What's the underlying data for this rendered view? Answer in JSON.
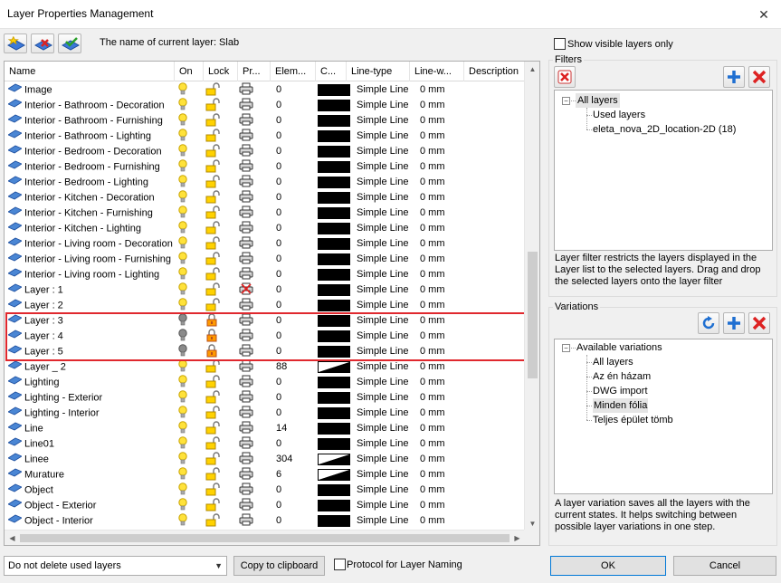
{
  "window": {
    "title": "Layer Properties Management",
    "close_glyph": "✕"
  },
  "toolbar": {
    "current_layer_text": "The name of current layer: Slab"
  },
  "columns": {
    "name": "Name",
    "on": "On",
    "lock": "Lock",
    "print": "Pr...",
    "elements": "Elem...",
    "color": "C...",
    "linetype": "Line-type",
    "linewidth": "Line-w...",
    "description": "Description"
  },
  "layers": [
    {
      "name": "Image",
      "on": true,
      "locked": false,
      "print": true,
      "elements": "0",
      "color": "solid",
      "linetype": "Simple Line",
      "linewidth": "0 mm"
    },
    {
      "name": "Interior - Bathroom - Decoration",
      "on": true,
      "locked": false,
      "print": true,
      "elements": "0",
      "color": "solid",
      "linetype": "Simple Line",
      "linewidth": "0 mm"
    },
    {
      "name": "Interior - Bathroom - Furnishing",
      "on": true,
      "locked": false,
      "print": true,
      "elements": "0",
      "color": "solid",
      "linetype": "Simple Line",
      "linewidth": "0 mm"
    },
    {
      "name": "Interior - Bathroom - Lighting",
      "on": true,
      "locked": false,
      "print": true,
      "elements": "0",
      "color": "solid",
      "linetype": "Simple Line",
      "linewidth": "0 mm"
    },
    {
      "name": "Interior - Bedroom - Decoration",
      "on": true,
      "locked": false,
      "print": true,
      "elements": "0",
      "color": "solid",
      "linetype": "Simple Line",
      "linewidth": "0 mm"
    },
    {
      "name": "Interior - Bedroom - Furnishing",
      "on": true,
      "locked": false,
      "print": true,
      "elements": "0",
      "color": "solid",
      "linetype": "Simple Line",
      "linewidth": "0 mm"
    },
    {
      "name": "Interior - Bedroom - Lighting",
      "on": true,
      "locked": false,
      "print": true,
      "elements": "0",
      "color": "solid",
      "linetype": "Simple Line",
      "linewidth": "0 mm"
    },
    {
      "name": "Interior - Kitchen - Decoration",
      "on": true,
      "locked": false,
      "print": true,
      "elements": "0",
      "color": "solid",
      "linetype": "Simple Line",
      "linewidth": "0 mm"
    },
    {
      "name": "Interior - Kitchen - Furnishing",
      "on": true,
      "locked": false,
      "print": true,
      "elements": "0",
      "color": "solid",
      "linetype": "Simple Line",
      "linewidth": "0 mm"
    },
    {
      "name": "Interior - Kitchen - Lighting",
      "on": true,
      "locked": false,
      "print": true,
      "elements": "0",
      "color": "solid",
      "linetype": "Simple Line",
      "linewidth": "0 mm"
    },
    {
      "name": "Interior - Living room - Decoration",
      "on": true,
      "locked": false,
      "print": true,
      "elements": "0",
      "color": "solid",
      "linetype": "Simple Line",
      "linewidth": "0 mm"
    },
    {
      "name": "Interior - Living room - Furnishing",
      "on": true,
      "locked": false,
      "print": true,
      "elements": "0",
      "color": "solid",
      "linetype": "Simple Line",
      "linewidth": "0 mm"
    },
    {
      "name": "Interior - Living room - Lighting",
      "on": true,
      "locked": false,
      "print": true,
      "elements": "0",
      "color": "solid",
      "linetype": "Simple Line",
      "linewidth": "0 mm"
    },
    {
      "name": "Layer :  1",
      "on": true,
      "locked": false,
      "print": false,
      "elements": "0",
      "color": "solid",
      "linetype": "Simple Line",
      "linewidth": "0 mm"
    },
    {
      "name": "Layer :  2",
      "on": true,
      "locked": false,
      "print": true,
      "elements": "0",
      "color": "solid",
      "linetype": "Simple Line",
      "linewidth": "0 mm"
    },
    {
      "name": "Layer :  3",
      "on": false,
      "locked": true,
      "print": true,
      "elements": "0",
      "color": "solid",
      "linetype": "Simple Line",
      "linewidth": "0 mm"
    },
    {
      "name": "Layer :  4",
      "on": false,
      "locked": true,
      "print": true,
      "elements": "0",
      "color": "solid",
      "linetype": "Simple Line",
      "linewidth": "0 mm"
    },
    {
      "name": "Layer :  5",
      "on": false,
      "locked": true,
      "print": true,
      "elements": "0",
      "color": "solid",
      "linetype": "Simple Line",
      "linewidth": "0 mm"
    },
    {
      "name": "Layer _ 2",
      "on": true,
      "locked": false,
      "print": true,
      "elements": "88",
      "color": "triangle",
      "linetype": "Simple Line",
      "linewidth": "0 mm"
    },
    {
      "name": "Lighting",
      "on": true,
      "locked": false,
      "print": true,
      "elements": "0",
      "color": "solid",
      "linetype": "Simple Line",
      "linewidth": "0 mm"
    },
    {
      "name": "Lighting - Exterior",
      "on": true,
      "locked": false,
      "print": true,
      "elements": "0",
      "color": "solid",
      "linetype": "Simple Line",
      "linewidth": "0 mm"
    },
    {
      "name": "Lighting - Interior",
      "on": true,
      "locked": false,
      "print": true,
      "elements": "0",
      "color": "solid",
      "linetype": "Simple Line",
      "linewidth": "0 mm"
    },
    {
      "name": "Line",
      "on": true,
      "locked": false,
      "print": true,
      "elements": "14",
      "color": "solid",
      "linetype": "Simple Line",
      "linewidth": "0 mm"
    },
    {
      "name": "Line01",
      "on": true,
      "locked": false,
      "print": true,
      "elements": "0",
      "color": "solid",
      "linetype": "Simple Line",
      "linewidth": "0 mm"
    },
    {
      "name": "Linee",
      "on": true,
      "locked": false,
      "print": true,
      "elements": "304",
      "color": "triangle",
      "linetype": "Simple Line",
      "linewidth": "0 mm"
    },
    {
      "name": "Murature",
      "on": true,
      "locked": false,
      "print": true,
      "elements": "6",
      "color": "triangle",
      "linetype": "Simple Line",
      "linewidth": "0 mm"
    },
    {
      "name": "Object",
      "on": true,
      "locked": false,
      "print": true,
      "elements": "0",
      "color": "solid",
      "linetype": "Simple Line",
      "linewidth": "0 mm"
    },
    {
      "name": "Object - Exterior",
      "on": true,
      "locked": false,
      "print": true,
      "elements": "0",
      "color": "solid",
      "linetype": "Simple Line",
      "linewidth": "0 mm"
    },
    {
      "name": "Object - Interior",
      "on": true,
      "locked": false,
      "print": true,
      "elements": "0",
      "color": "solid",
      "linetype": "Simple Line",
      "linewidth": "0 mm"
    }
  ],
  "bottom": {
    "delete_option": "Do not delete used layers",
    "copy_button": "Copy to clipboard",
    "protocol_label": "Protocol for Layer Naming",
    "ok": "OK",
    "cancel": "Cancel"
  },
  "right": {
    "show_visible_label": "Show visible layers only",
    "filters_title": "Filters",
    "filters_tree": {
      "root": "All layers",
      "children": [
        "Used layers",
        "eleta_nova_2D_location-2D (18)"
      ]
    },
    "filters_desc": "Layer filter restricts the layers displayed in the Layer list to the selected layers. Drag and drop the selected layers onto the layer filter",
    "variations_title": "Variations",
    "variations_tree": {
      "root": "Available variations",
      "children": [
        "All layers",
        "Az én házam",
        "DWG import",
        "Minden fólia",
        "Teljes épület tömb"
      ]
    },
    "variations_desc": "A layer variation saves all the layers with the current states. It helps switching between possible layer variations in one step."
  }
}
